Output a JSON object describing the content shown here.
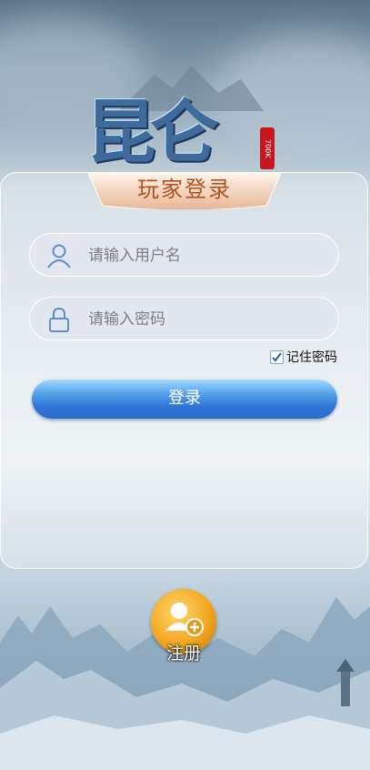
{
  "title": "玩家登录",
  "logo": {
    "text": "昆仑",
    "badge": "700K"
  },
  "username": {
    "placeholder": "请输入用户名",
    "icon": "user-icon"
  },
  "password": {
    "placeholder": "请输入密码",
    "icon": "lock-icon"
  },
  "remember": {
    "label": "记住密码",
    "checked": true
  },
  "login_button": "登录",
  "register_button": "注册",
  "colors": {
    "accent": "#2f74d6",
    "title": "#b0531f",
    "register": "#f2a71f"
  }
}
